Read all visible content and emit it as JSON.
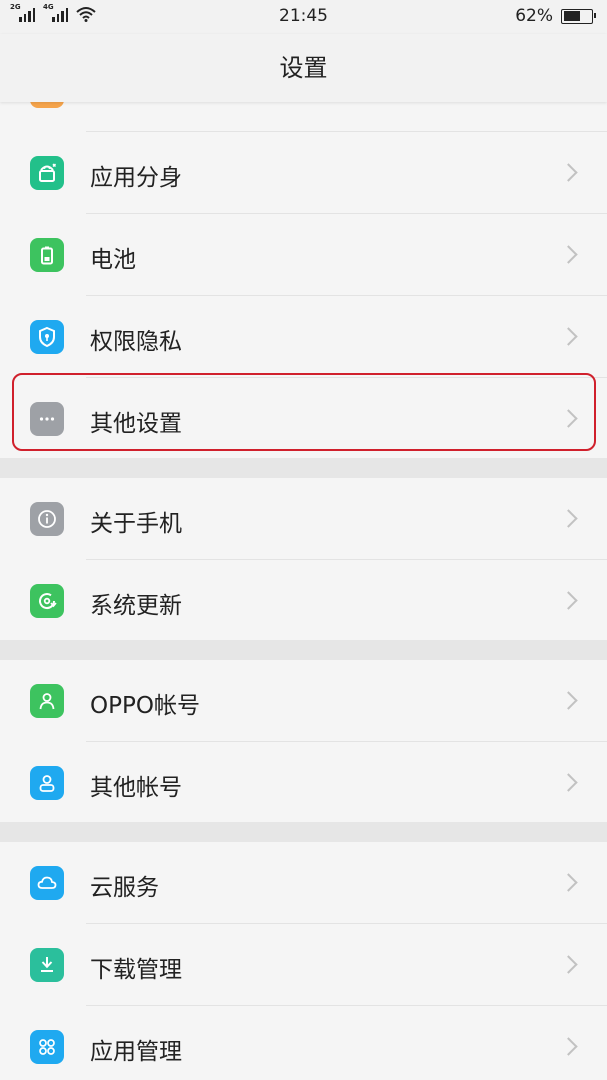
{
  "status_bar": {
    "sim1": "2G",
    "sim2": "4G",
    "time": "21:45",
    "battery_pct": "62%",
    "battery_level": 0.62
  },
  "header": {
    "title": "设置"
  },
  "colors": {
    "app_clone": "#22c08a",
    "battery": "#3dc35f",
    "privacy": "#1fa9f0",
    "other_settings": "#9ea1a6",
    "about_phone": "#9ea1a6",
    "system_update": "#3dc35f",
    "oppo_account": "#3dc35f",
    "other_accounts": "#1fa9f0",
    "cloud": "#1fa9f0",
    "download": "#2bbf9c",
    "app_manage": "#1fa9f0",
    "highlight": "#d0202c"
  },
  "items": [
    {
      "label": "应用分身",
      "icon": "android-clone-icon"
    },
    {
      "label": "电池",
      "icon": "battery-icon"
    },
    {
      "label": "权限隐私",
      "icon": "shield-lock-icon"
    },
    {
      "label": "其他设置",
      "icon": "more-dots-icon"
    },
    {
      "label": "关于手机",
      "icon": "info-icon"
    },
    {
      "label": "系统更新",
      "icon": "update-icon"
    },
    {
      "label": "OPPO帐号",
      "icon": "person-icon"
    },
    {
      "label": "其他帐号",
      "icon": "person-outline-icon"
    },
    {
      "label": "云服务",
      "icon": "cloud-icon"
    },
    {
      "label": "下载管理",
      "icon": "download-icon"
    },
    {
      "label": "应用管理",
      "icon": "apps-grid-icon"
    }
  ]
}
